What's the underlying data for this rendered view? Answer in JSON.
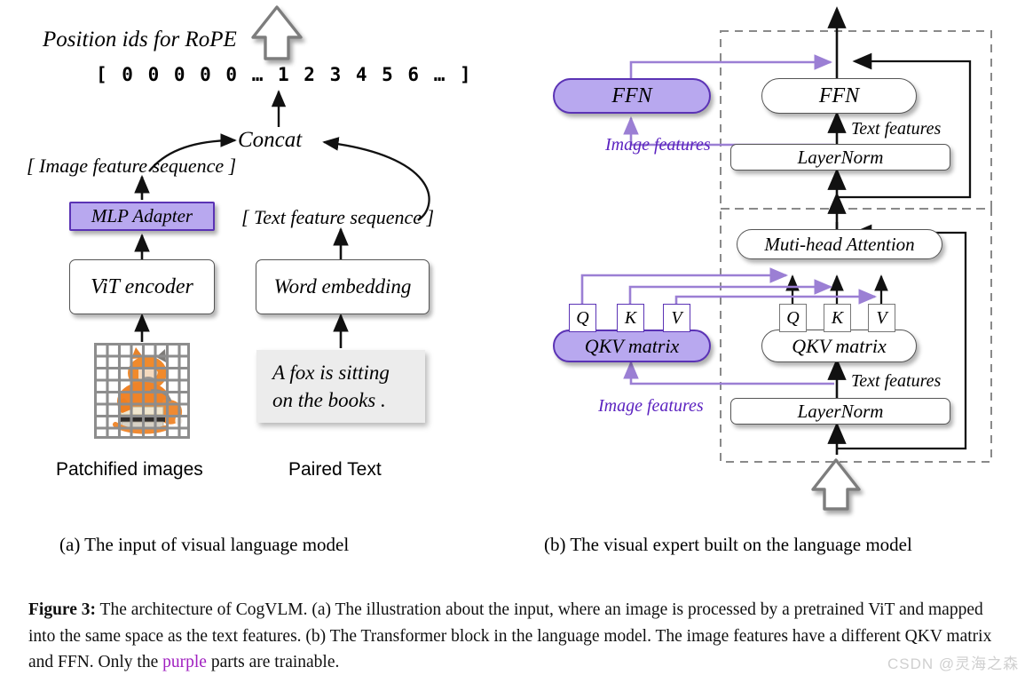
{
  "figure": {
    "label": "Figure 3:",
    "caption_rest": " The architecture of CogVLM. (a) The illustration about the input, where an image is processed by a pretrained ViT and mapped into the same space as the text features. (b) The Transformer block in the language model. The image features have a different QKV matrix and FFN. Only the ",
    "caption_purple_word": "purple",
    "caption_tail": " parts are trainable.",
    "watermark": "CSDN @灵海之森"
  },
  "subcaptions": {
    "a": "(a) The input of visual language model",
    "b": "(b) The visual expert built on the language model"
  },
  "colors": {
    "trainable_purple_fill": "#b8a8ef",
    "trainable_purple_border": "#5b33b5",
    "purple_arrow": "#9b7fd4",
    "purple_label_text": "#5b22c0",
    "box_border": "#555555",
    "dashed_border": "#888888",
    "text_blob_bg": "#ececec"
  },
  "panel_a": {
    "title_label": "Position ids for RoPE",
    "position_ids": "[  0   0   0   0   0   …   1   2   3   4   5   6   …   ]",
    "concat_label": "Concat",
    "image_feature_sequence": "[ Image feature sequence ]",
    "text_feature_sequence": "[ Text  feature sequence ]",
    "mlp_adapter": "MLP Adapter",
    "vit_encoder": "ViT encoder",
    "word_embedding": "Word embedding",
    "sample_text_line1": "A fox is sitting",
    "sample_text_line2": "on the books .",
    "patchified_caption": "Patchified images",
    "paired_text_caption": "Paired Text",
    "output_arrow": "up-arrow-icon"
  },
  "panel_b": {
    "image_branch": {
      "ffn": "FFN",
      "qkv_matrix": "QKV matrix",
      "qkv_cells": [
        "Q",
        "K",
        "V"
      ],
      "label_top": "Image features",
      "label_bottom": "Image features"
    },
    "text_branch": {
      "ffn": "FFN",
      "layernorm_top": "LayerNorm",
      "attention": "Muti-head Attention",
      "qkv_matrix": "QKV matrix",
      "qkv_cells": [
        "Q",
        "K",
        "V"
      ],
      "layernorm_bottom": "LayerNorm",
      "label_top": "Text features",
      "label_bottom": "Text features"
    },
    "input_arrow": "up-arrow-icon",
    "output_arrow": "up-arrow-icon"
  }
}
